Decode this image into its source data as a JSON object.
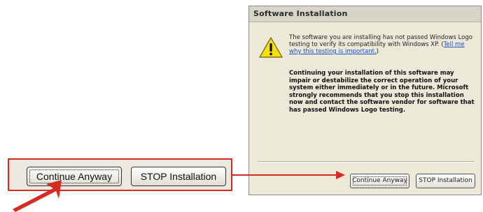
{
  "dialog": {
    "title": "Software Installation",
    "message_pre_link": "The software you are installing has not passed Windows Logo testing to verify its compatibility with Windows XP. (",
    "message_link": "Tell me why this testing is important.",
    "message_post_link": ")",
    "warning": "Continuing your installation of this software may impair or destabilize the correct operation of your system either immediately or in the future. Microsoft strongly recommends that you stop this installation now and contact the software vendor for software that has passed Windows Logo testing.",
    "continue_label": "Continue Anyway",
    "stop_label": "STOP Installation",
    "icon": "warning-icon"
  },
  "callout": {
    "continue_label": "Continue Anyway",
    "stop_label": "STOP Installation"
  },
  "colors": {
    "highlight": "#d92a22",
    "link": "#1a50c6",
    "dialog_bg": "#ece9d8"
  }
}
